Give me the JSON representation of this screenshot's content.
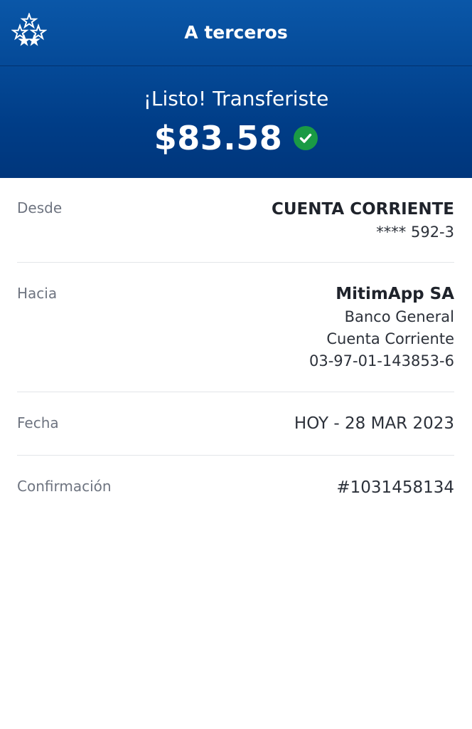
{
  "header": {
    "title": "A terceros",
    "logo_icon": "bank-stars-logo-icon",
    "success_message": "¡Listo! Transferiste",
    "amount": "$83.58",
    "status_icon": "check-circle-icon",
    "colors": {
      "header_top": "#0a57a8",
      "header_bottom": "#00367c",
      "success_green": "#1a9a45"
    }
  },
  "details": {
    "from": {
      "label": "Desde",
      "account_type": "CUENTA CORRIENTE",
      "account_number": "**** 592-3"
    },
    "to": {
      "label": "Hacia",
      "name": "MitimApp SA",
      "bank": "Banco General",
      "account_type": "Cuenta Corriente",
      "account_number": "03-97-01-143853-6"
    },
    "date": {
      "label": "Fecha",
      "value": "HOY - 28 MAR 2023"
    },
    "confirmation": {
      "label": "Confirmación",
      "value": "#1031458134"
    }
  }
}
